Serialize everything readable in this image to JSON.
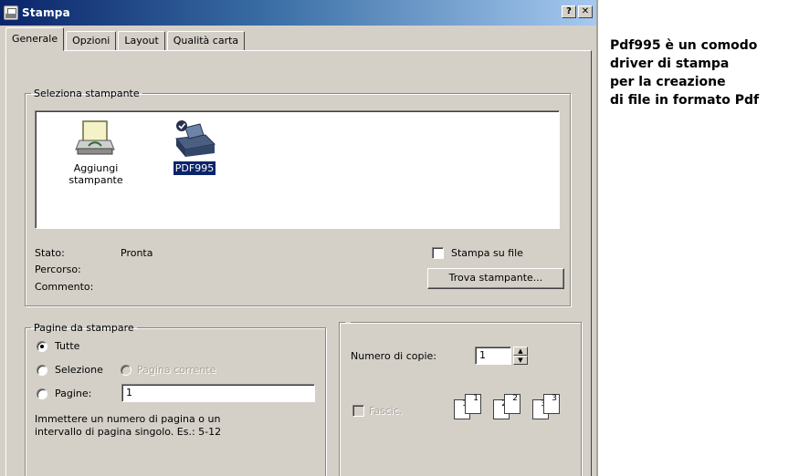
{
  "window": {
    "title": "Stampa",
    "help_label": "?",
    "close_label": "✕"
  },
  "tabs": [
    {
      "label": "Generale",
      "active": true
    },
    {
      "label": "Opzioni",
      "active": false
    },
    {
      "label": "Layout",
      "active": false
    },
    {
      "label": "Qualità carta",
      "active": false
    }
  ],
  "printer_group": {
    "legend": "Seleziona stampante",
    "printers": [
      {
        "label_line1": "Aggiungi",
        "label_line2": "stampante",
        "icon": "add-printer-icon"
      },
      {
        "label": "PDF995",
        "icon": "printer-icon",
        "selected": true
      }
    ],
    "status_label": "Stato:",
    "status_value": "Pronta",
    "path_label": "Percorso:",
    "comment_label": "Commento:",
    "print_to_file_label": "Stampa su file",
    "find_printer_label": "Trova stampante..."
  },
  "pages_group": {
    "legend": "Pagine da stampare",
    "all_label": "Tutte",
    "selection_label": "Selezione",
    "current_page_label": "Pagina corrente",
    "pages_label": "Pagine:",
    "pages_value": "1",
    "hint_line1": "Immettere un numero di pagina o un",
    "hint_line2": "intervallo di pagina singolo. Es.: 5-12"
  },
  "copies_group": {
    "copies_label": "Numero di copie:",
    "copies_value": "1",
    "collate_label": "Fascic.",
    "collate_pages": [
      "1",
      "1",
      "2",
      "2",
      "3",
      "3"
    ]
  },
  "side_caption": {
    "lines": [
      "Pdf995 è un comodo",
      "driver di stampa",
      "per la creazione",
      "di file in formato Pdf"
    ]
  },
  "colors": {
    "titlebar": "#0a246a",
    "dialog_bg": "#d4d0c8",
    "selection": "#0a246a"
  }
}
